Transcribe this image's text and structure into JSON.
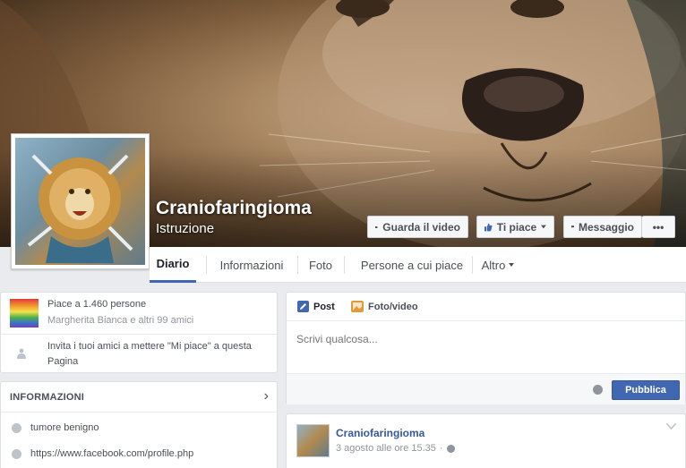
{
  "page": {
    "name": "Craniofaringioma",
    "category": "Istruzione"
  },
  "cover_buttons": {
    "video": "Guarda il video",
    "like": "Ti piace",
    "message": "Messaggio",
    "more": "•••"
  },
  "tabs": [
    "Diario",
    "Informazioni",
    "Foto",
    "Persone a cui piace",
    "Altro"
  ],
  "likes": {
    "main": "Piace a 1.460 persone",
    "sub": "Margherita Bianca e altri 99 amici",
    "invite": "Invita i tuoi amici a mettere \"Mi piace\" a questa Pagina"
  },
  "info": {
    "header": "INFORMAZIONI",
    "rows": [
      "tumore benigno",
      "https://www.facebook.com/profile.php"
    ]
  },
  "composer": {
    "tab_post": "Post",
    "tab_photo": "Foto/video",
    "placeholder": "Scrivi qualcosa...",
    "publish": "Pubblica"
  },
  "post": {
    "author": "Craniofaringioma",
    "date": "3 agosto alle ore 15.35"
  },
  "colors": {
    "brand_blue": "#4267b2",
    "link_blue": "#365899",
    "background": "#e9ebee"
  }
}
